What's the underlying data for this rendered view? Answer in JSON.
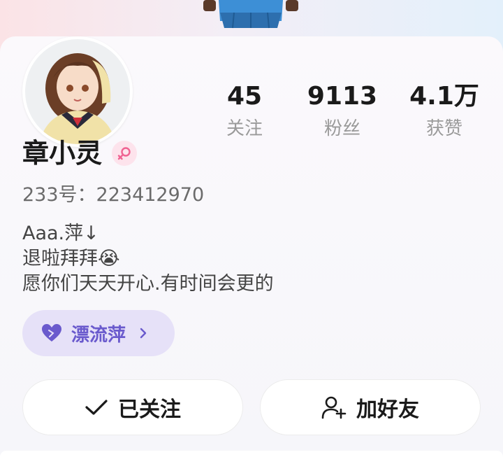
{
  "profile": {
    "name": "章小灵",
    "uid_line": "233号：223412970",
    "bio": "Aaa.萍↓\n退啦拜拜😭\n愿你们天天开心.有时间会更的"
  },
  "stats": [
    {
      "value": "45",
      "label": "关注"
    },
    {
      "value": "9113",
      "label": "粉丝"
    },
    {
      "value": "4.1万",
      "label": "获赞"
    }
  ],
  "tag": {
    "label": "漂流萍",
    "icon": "heart-icon"
  },
  "actions": {
    "follow_label": "已关注",
    "follow_icon": "check-icon",
    "friend_label": "加好友",
    "friend_icon": "add-user-icon"
  },
  "colors": {
    "accent": "#6a5acd",
    "tag_bg": "#e6e1f8",
    "gender": "#f06292"
  }
}
